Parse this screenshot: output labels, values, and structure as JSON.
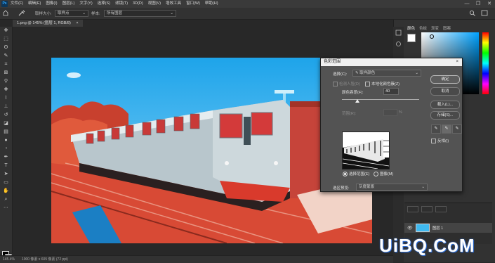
{
  "app": {
    "logo": "Ps"
  },
  "menu": [
    "文件(F)",
    "编辑(E)",
    "图像(I)",
    "图层(L)",
    "文字(Y)",
    "选择(S)",
    "滤镜(T)",
    "3D(D)",
    "视图(V)",
    "增效工具",
    "窗口(W)",
    "帮助(H)"
  ],
  "window_controls": {
    "minimize": "—",
    "restore": "❐",
    "close": "✕"
  },
  "options_bar": {
    "sample_size_label": "取样大小:",
    "sample_size_value": "取样点",
    "sample_label": "样本:",
    "sample_value": "所有图层"
  },
  "document_tab": {
    "title": "1.png @ 145% (图层 1, RGB/8)",
    "close": "×"
  },
  "status_bar": {
    "zoom": "145.4%",
    "info": "1000 像素 x 605 像素 (72 ppi)"
  },
  "right_panel": {
    "tabs": [
      "颜色",
      "色板",
      "渐变",
      "图案"
    ],
    "layer_name": "图层 1"
  },
  "dialog": {
    "title": "色彩范围",
    "close": "×",
    "select_label": "选择(C):",
    "select_value": "取样颜色",
    "detect_faces": "检测人脸(D)",
    "localized_clusters": "本地化颜色簇(Z)",
    "fuzziness_label": "颜色容差(F):",
    "fuzziness_value": "40",
    "fuzziness_fraction": 0.2,
    "range_label": "范围(R):",
    "range_unit": "%",
    "radio_selection": "选择范围(E)",
    "radio_image": "图像(M)",
    "selection_preview_label": "选区预览:",
    "selection_preview_value": "灰度蒙版",
    "buttons": {
      "ok": "确定",
      "cancel": "取消",
      "load": "载入(L)...",
      "save": "存储(S)..."
    },
    "invert_label": "反相(I)"
  },
  "watermark": {
    "text": "UiBQ.CoM"
  },
  "colors": {
    "sky": "#3fb9f0",
    "tint": "#e04a36",
    "accent": "#31a8ff"
  }
}
